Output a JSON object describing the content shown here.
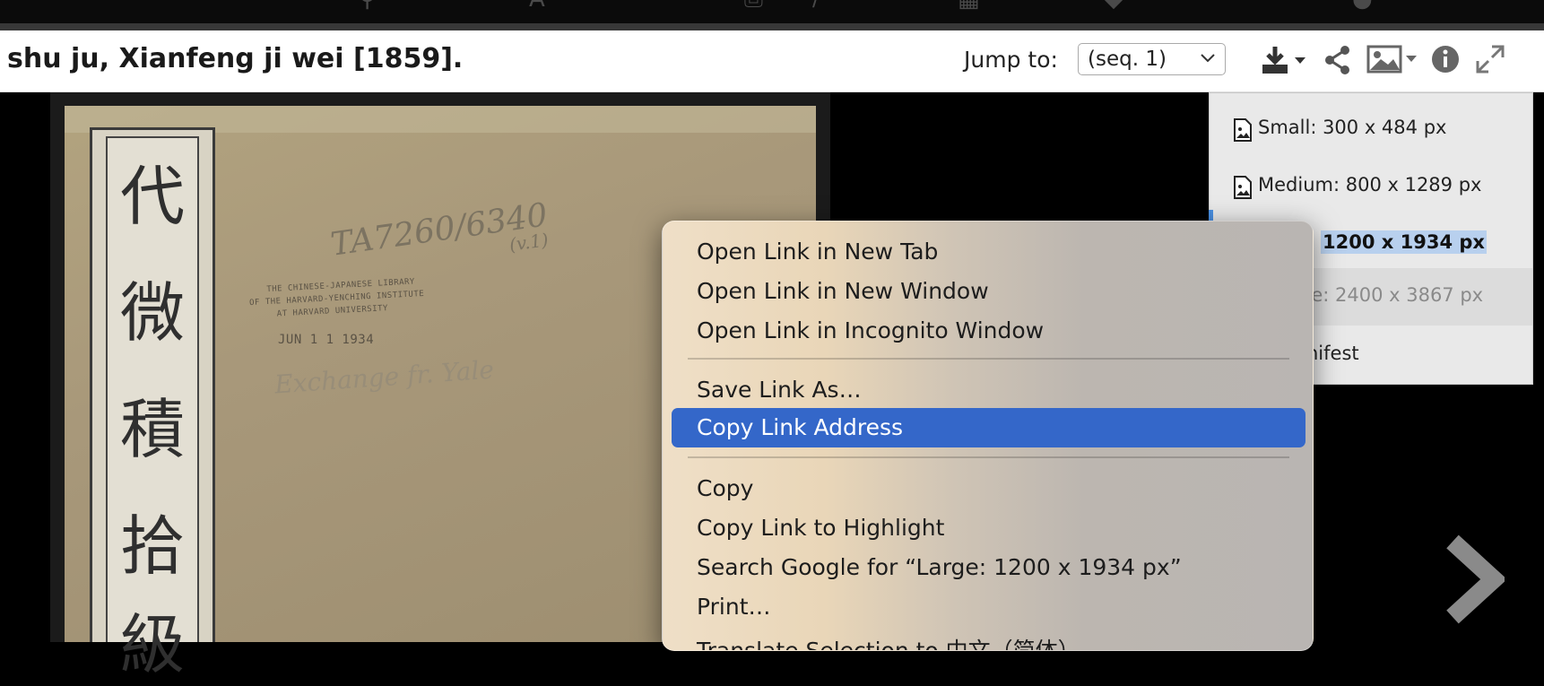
{
  "header": {
    "title": "shu ju, Xianfeng ji wei [1859].",
    "jump_label": "Jump to:",
    "jump_value": "(seq. 1)"
  },
  "toolbar_icons": [
    "download-icon",
    "share-icon",
    "image-size-icon",
    "info-icon",
    "fullscreen-icon"
  ],
  "top_bar_partial": [
    "search-icon",
    "text-icon",
    "print-icon",
    "/",
    "grid-icon",
    "tag-icon",
    "help-icon"
  ],
  "image_size_menu": {
    "items": [
      {
        "label": "Small: 300 x 484 px"
      },
      {
        "label": "Medium: 800 x 1289 px"
      },
      {
        "label": "1200 x 1934 px",
        "highlighted": true
      },
      {
        "label": "ge: 2400 x 3867 px",
        "disabled": true
      },
      {
        "label": "nifest"
      }
    ]
  },
  "context_menu": {
    "items": [
      "Open Link in New Tab",
      "Open Link in New Window",
      "Open Link in Incognito Window",
      "Save Link As…",
      "Copy Link Address",
      "Copy",
      "Copy Link to Highlight",
      "Search Google for “Large: 1200 x 1934 px”",
      "Print…",
      "Translate Selection to 中文（简体）"
    ],
    "active": "Copy Link Address"
  },
  "scan": {
    "spine_chars": [
      "代",
      "微",
      "積",
      "拾",
      "級"
    ],
    "handwritten_callno": "TA7260/6340",
    "handwritten_vol": "(v.1)",
    "stamp_lines": [
      "THE CHINESE-JAPANESE LIBRARY",
      "OF THE HARVARD-YENCHING INSTITUTE",
      "AT HARVARD UNIVERSITY"
    ],
    "date_stamp": "JUN 1 1 1934",
    "exchange_note": "Exchange fr. Yale"
  },
  "colors": {
    "context_active": "#3467c9",
    "selection_highlight": "#b8d0ee",
    "page_background": "#000000"
  }
}
